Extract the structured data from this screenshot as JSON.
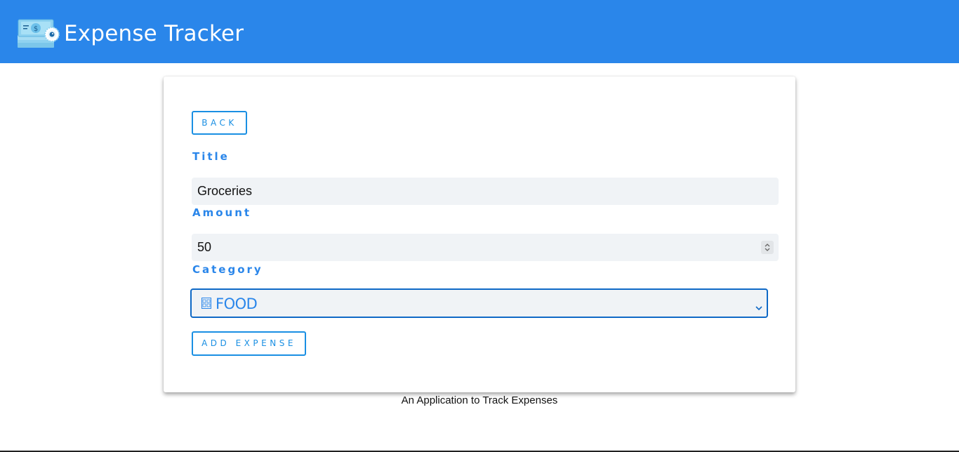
{
  "header": {
    "app_title": "Expense Tracker",
    "logo_icon": "money-stack-icon",
    "background_color": "#2a86ea"
  },
  "form": {
    "back_label": "BACK",
    "title_label": "Title",
    "title_value": "Groceries",
    "amount_label": "Amount",
    "amount_value": "50",
    "category_label": "Category",
    "category_value": "FOOD",
    "category_icon": "food-icon",
    "add_label": "ADD EXPENSE"
  },
  "footer": {
    "tagline": "An Application to Track Expenses"
  },
  "colors": {
    "accent": "#2a86ea",
    "button_text": "#1a8fe3",
    "input_bg": "#f0f3f6",
    "focus_border": "#0f69c6"
  }
}
